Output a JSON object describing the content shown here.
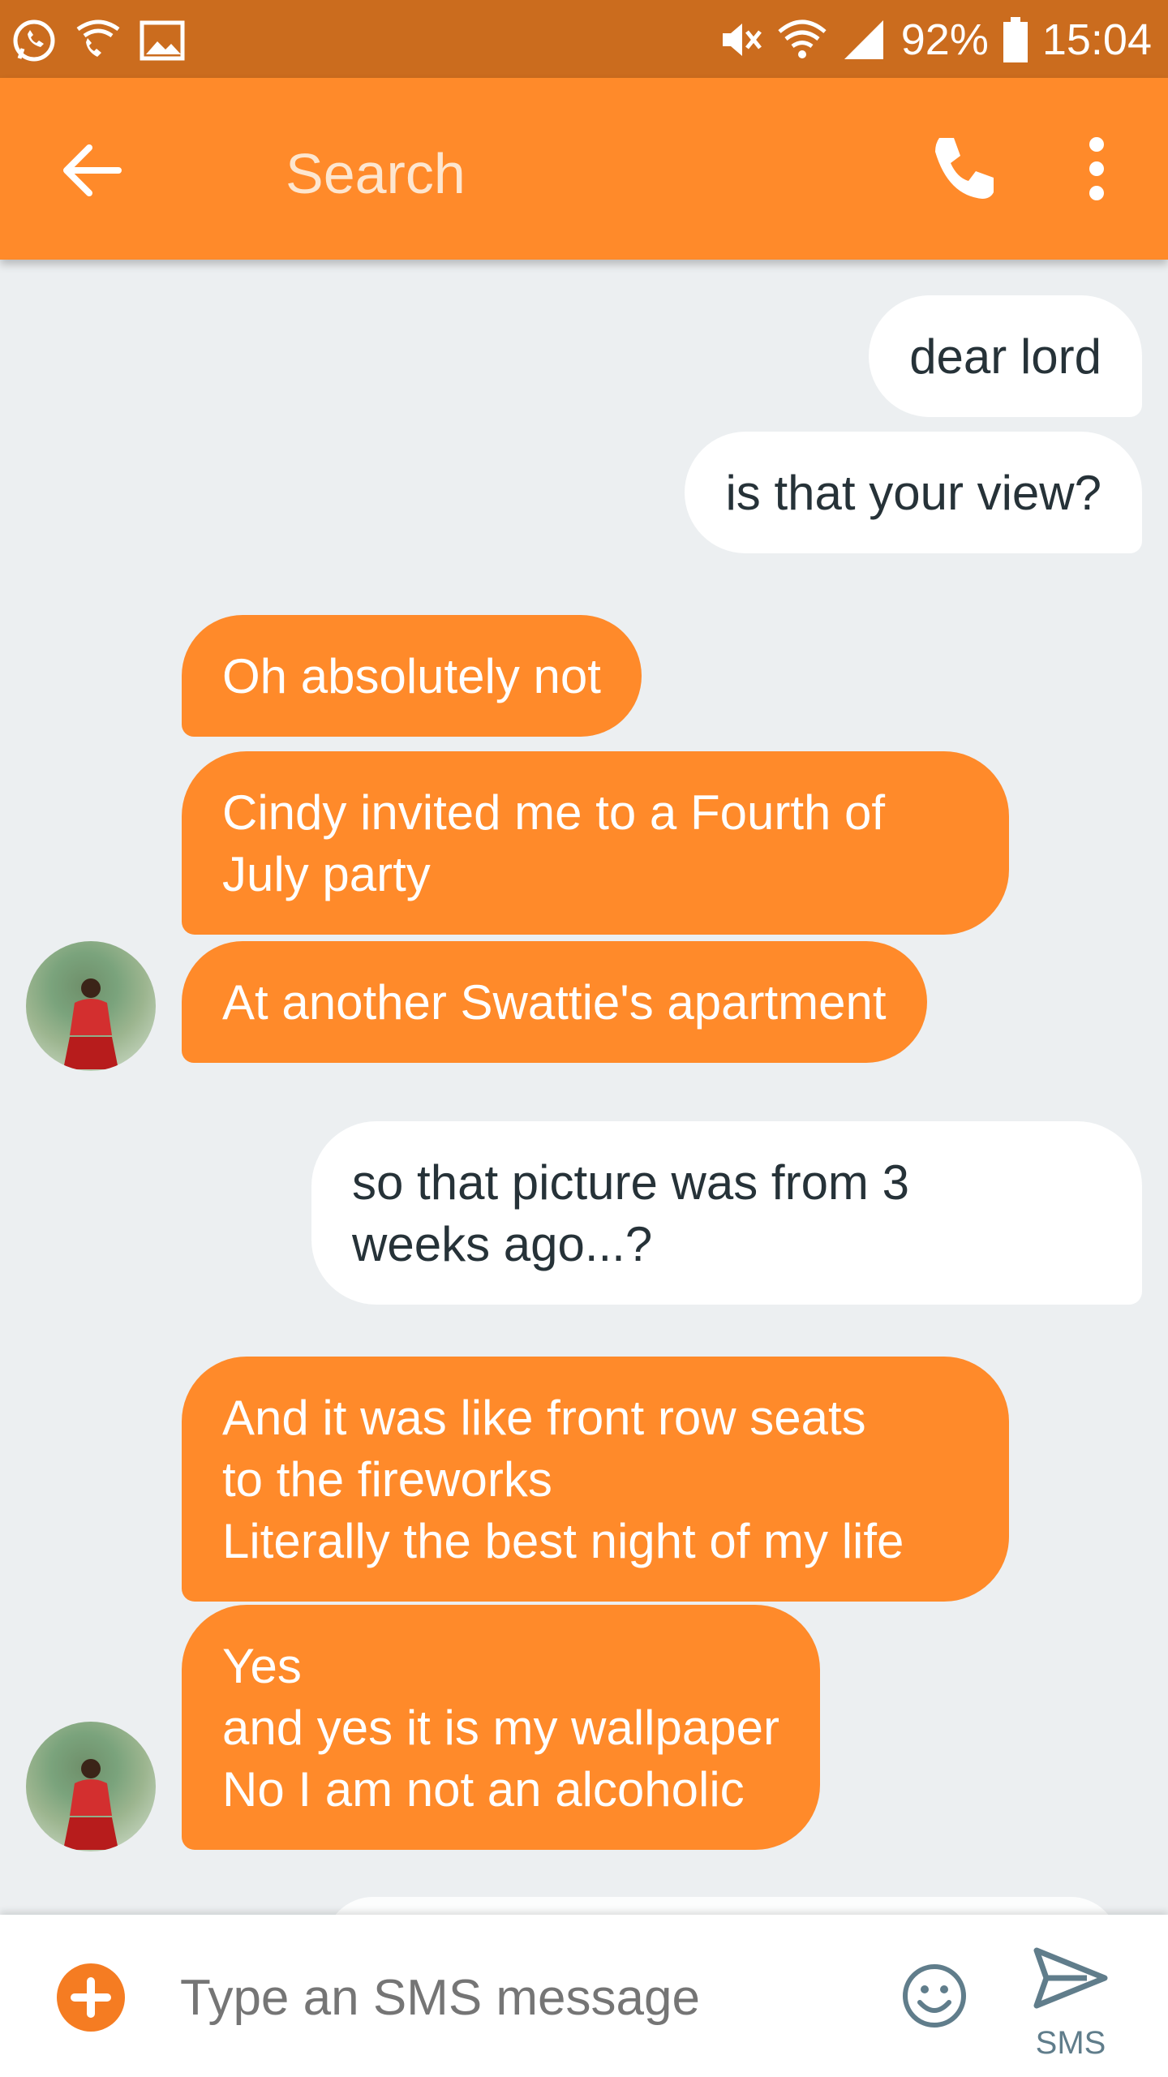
{
  "status_bar": {
    "battery": "92%",
    "time": "15:04",
    "icons": [
      "whatsapp-icon",
      "wifi-call-icon",
      "image-icon",
      "mute-icon",
      "wifi-icon",
      "signal-icon",
      "battery-icon"
    ]
  },
  "app_bar": {
    "title": "Search",
    "icons": [
      "back-arrow-icon",
      "phone-icon",
      "more-vert-icon"
    ]
  },
  "colors": {
    "accent": "#ff8a2a",
    "status_bar": "#cb6c1e",
    "outgoing_bubble": "#ffffff",
    "background": "#eceff1"
  },
  "messages": [
    {
      "direction": "outgoing",
      "text": "dear lord"
    },
    {
      "direction": "outgoing",
      "text": "is that your view?"
    },
    {
      "direction": "incoming",
      "text": "Oh absolutely not"
    },
    {
      "direction": "incoming",
      "text": "Cindy invited me to a Fourth of\nJuly party"
    },
    {
      "direction": "incoming",
      "text": "At another Swattie's apartment"
    },
    {
      "direction": "outgoing",
      "text": "so that picture was from 3\nweeks ago...?"
    },
    {
      "direction": "incoming",
      "text": "And it was like front row seats\nto the fireworks\nLiterally the best night of my life"
    },
    {
      "direction": "incoming",
      "text": "Yes\nand yes it is my wallpaper\nNo I am not an alcoholic"
    }
  ],
  "composer": {
    "placeholder": "Type an SMS message",
    "send_label": "SMS",
    "icons": [
      "add-icon",
      "emoji-icon",
      "send-icon"
    ]
  }
}
